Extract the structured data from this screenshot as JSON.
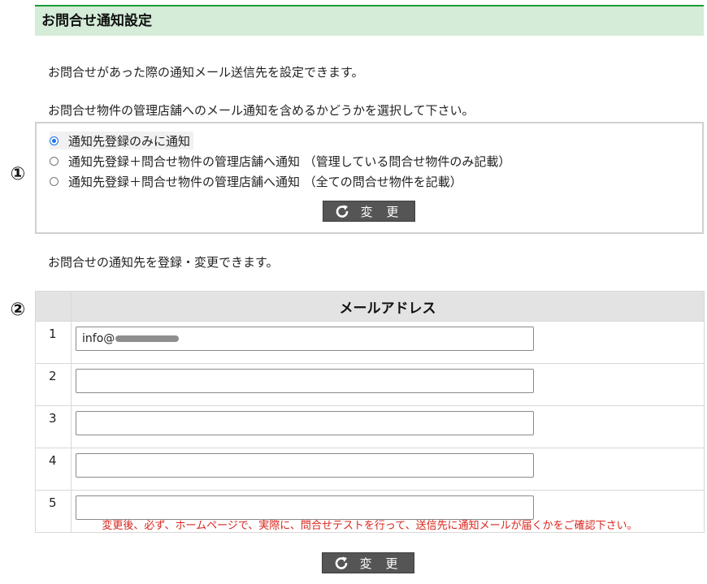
{
  "header": {
    "title": "お問合せ通知設定"
  },
  "section1": {
    "marker": "①",
    "description": "お問合せがあった際の通知メール送信先を設定できます。",
    "instruction": "お問合せ物件の管理店舗へのメール通知を含めるかどうかを選択して下さい。",
    "options": [
      {
        "label": "通知先登録のみに通知",
        "selected": true
      },
      {
        "label": "通知先登録＋問合せ物件の管理店舗へ通知 （管理している問合せ物件のみ記載）",
        "selected": false
      },
      {
        "label": "通知先登録＋問合せ物件の管理店舗へ通知 （全ての問合せ物件を記載）",
        "selected": false
      }
    ],
    "button_label": "変 更"
  },
  "section2": {
    "marker": "②",
    "description": "お問合せの通知先を登録・変更できます。",
    "table": {
      "header": "メールアドレス",
      "rows": [
        {
          "num": "1",
          "value": "info@"
        },
        {
          "num": "2",
          "value": ""
        },
        {
          "num": "3",
          "value": ""
        },
        {
          "num": "4",
          "value": ""
        },
        {
          "num": "5",
          "value": ""
        }
      ]
    },
    "warning": "変更後、必ず、ホームページで、実際に、問合せテストを行って、送信先に通知メールが届くかをご確認下さい。",
    "button_label": "変 更"
  },
  "icons": {
    "button_icon": "refresh-icon"
  },
  "colors": {
    "header_bg": "#d4ecd8",
    "header_border": "#1e9b3a",
    "button_bg": "#555555",
    "warning": "#d9261c",
    "radio_accent": "#1a73e8"
  }
}
